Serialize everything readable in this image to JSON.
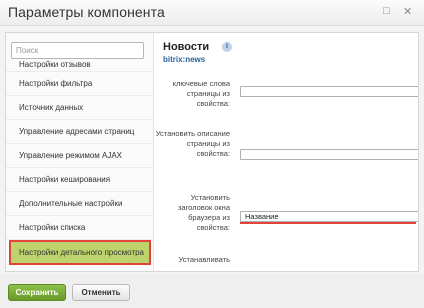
{
  "window": {
    "title": "Параметры компонента",
    "maximize_icon": "maximize-icon",
    "close_icon": "close-icon"
  },
  "sidebar": {
    "search_placeholder": "Поиск",
    "items": [
      {
        "label": "Настройки отзывов"
      },
      {
        "label": "Настройки фильтра"
      },
      {
        "label": "Источник данных"
      },
      {
        "label": "Управление адресами страниц"
      },
      {
        "label": "Управление режимом AJAX"
      },
      {
        "label": "Настройки кеширования"
      },
      {
        "label": "Дополнительные настройки"
      },
      {
        "label": "Настройки списка"
      },
      {
        "label": "Настройки детального просмотра",
        "active": true
      }
    ]
  },
  "component": {
    "title": "Новости",
    "code": "bitrix:news",
    "info_icon": "info-icon"
  },
  "fields": [
    {
      "label": "ключевые слова страницы из свойства:",
      "value": ""
    },
    {
      "label": "Установить описание страницы из свойства:",
      "value": ""
    },
    {
      "label": "Установить заголовок окна браузера из свойства:",
      "value": "Название"
    },
    {
      "label": "Устанавливать",
      "value": ""
    }
  ],
  "footer": {
    "save_label": "Сохранить",
    "cancel_label": "Отменить"
  },
  "colors": {
    "accent_green": "#8dc04a",
    "active_item": "#bfd36d",
    "highlight_red": "#e0443a"
  }
}
